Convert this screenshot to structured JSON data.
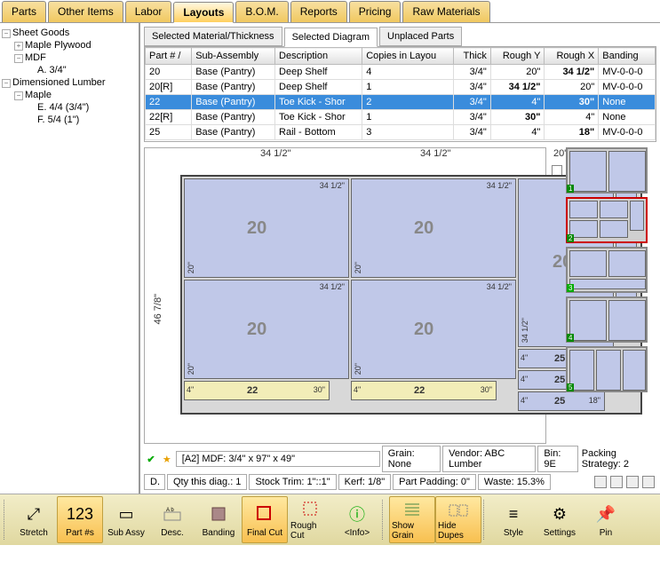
{
  "tabs": [
    "Parts",
    "Other Items",
    "Labor",
    "Layouts",
    "B.O.M.",
    "Reports",
    "Pricing",
    "Raw Materials"
  ],
  "active_tab": "Layouts",
  "tree": {
    "sheet_goods": "Sheet Goods",
    "maple_plywood": "Maple Plywood",
    "mdf": "MDF",
    "mdf_a": "A. 3/4\"",
    "dim_lumber": "Dimensioned Lumber",
    "maple": "Maple",
    "maple_e": "E. 4/4 (3/4\")",
    "maple_f": "F. 5/4 (1\")"
  },
  "inner_tabs": [
    "Selected Material/Thickness",
    "Selected Diagram",
    "Unplaced Parts"
  ],
  "active_inner_tab": "Selected Diagram",
  "grid": {
    "cols": [
      "Part # /",
      "Sub-Assembly",
      "Description",
      "Copies in Layou",
      "Thick",
      "Rough Y",
      "Rough X",
      "Banding"
    ],
    "rows": [
      {
        "p": "20",
        "s": "Base (Pantry)",
        "d": "Deep Shelf",
        "c": "4",
        "t": "3/4\"",
        "ry": "20\"",
        "rx": "34 1/2\"",
        "b": "MV-0-0-0"
      },
      {
        "p": "20[R]",
        "s": "Base (Pantry)",
        "d": "Deep Shelf",
        "c": "1",
        "t": "3/4\"",
        "ry": "34 1/2\"",
        "rx": "20\"",
        "b": "MV-0-0-0"
      },
      {
        "p": "22",
        "s": "Base (Pantry)",
        "d": "Toe Kick - Shor",
        "c": "2",
        "t": "3/4\"",
        "ry": "4\"",
        "rx": "30\"",
        "b": "None",
        "sel": true
      },
      {
        "p": "22[R]",
        "s": "Base (Pantry)",
        "d": "Toe Kick - Shor",
        "c": "1",
        "t": "3/4\"",
        "ry": "30\"",
        "rx": "4\"",
        "b": "None"
      },
      {
        "p": "25",
        "s": "Base (Pantry)",
        "d": "Rail - Bottom",
        "c": "3",
        "t": "3/4\"",
        "ry": "4\"",
        "rx": "18\"",
        "b": "MV-0-0-0"
      }
    ]
  },
  "ruler": {
    "x": [
      "34 1/2\"",
      "34 1/2\"",
      "20\"",
      "4\""
    ],
    "y": "46 7/8\""
  },
  "parts": {
    "p20": "20",
    "d34": "34 1/2\"",
    "d20": "20\"",
    "d4": "4\"",
    "d30": "30\"",
    "p22": "22",
    "p25": "25",
    "d18": "18\""
  },
  "info1": {
    "sheet": "[A2] MDF: 3/4\" x 97\" x 49\"",
    "grain": "Grain: None",
    "vendor": "Vendor: ABC Lumber",
    "bin": "Bin: 9E",
    "packing_label": "Packing Strategy: 2"
  },
  "info2": {
    "d": "D.",
    "qty": "Qty this diag.: 1",
    "stock": "Stock Trim: 1\"::1\"",
    "kerf": "Kerf: 1/8\"",
    "pad": "Part Padding: 0\"",
    "waste": "Waste: 15.3%"
  },
  "toolbar": {
    "stretch": "Stretch",
    "partns": "Part #s",
    "subassy": "Sub Assy",
    "desc": "Desc.",
    "banding": "Banding",
    "finalcut": "Final Cut",
    "roughcut": "Rough Cut",
    "info": "<Info>",
    "showgrain": "Show Grain",
    "hidedupes": "Hide Dupes",
    "style": "Style",
    "settings": "Settings",
    "pin": "Pin"
  }
}
